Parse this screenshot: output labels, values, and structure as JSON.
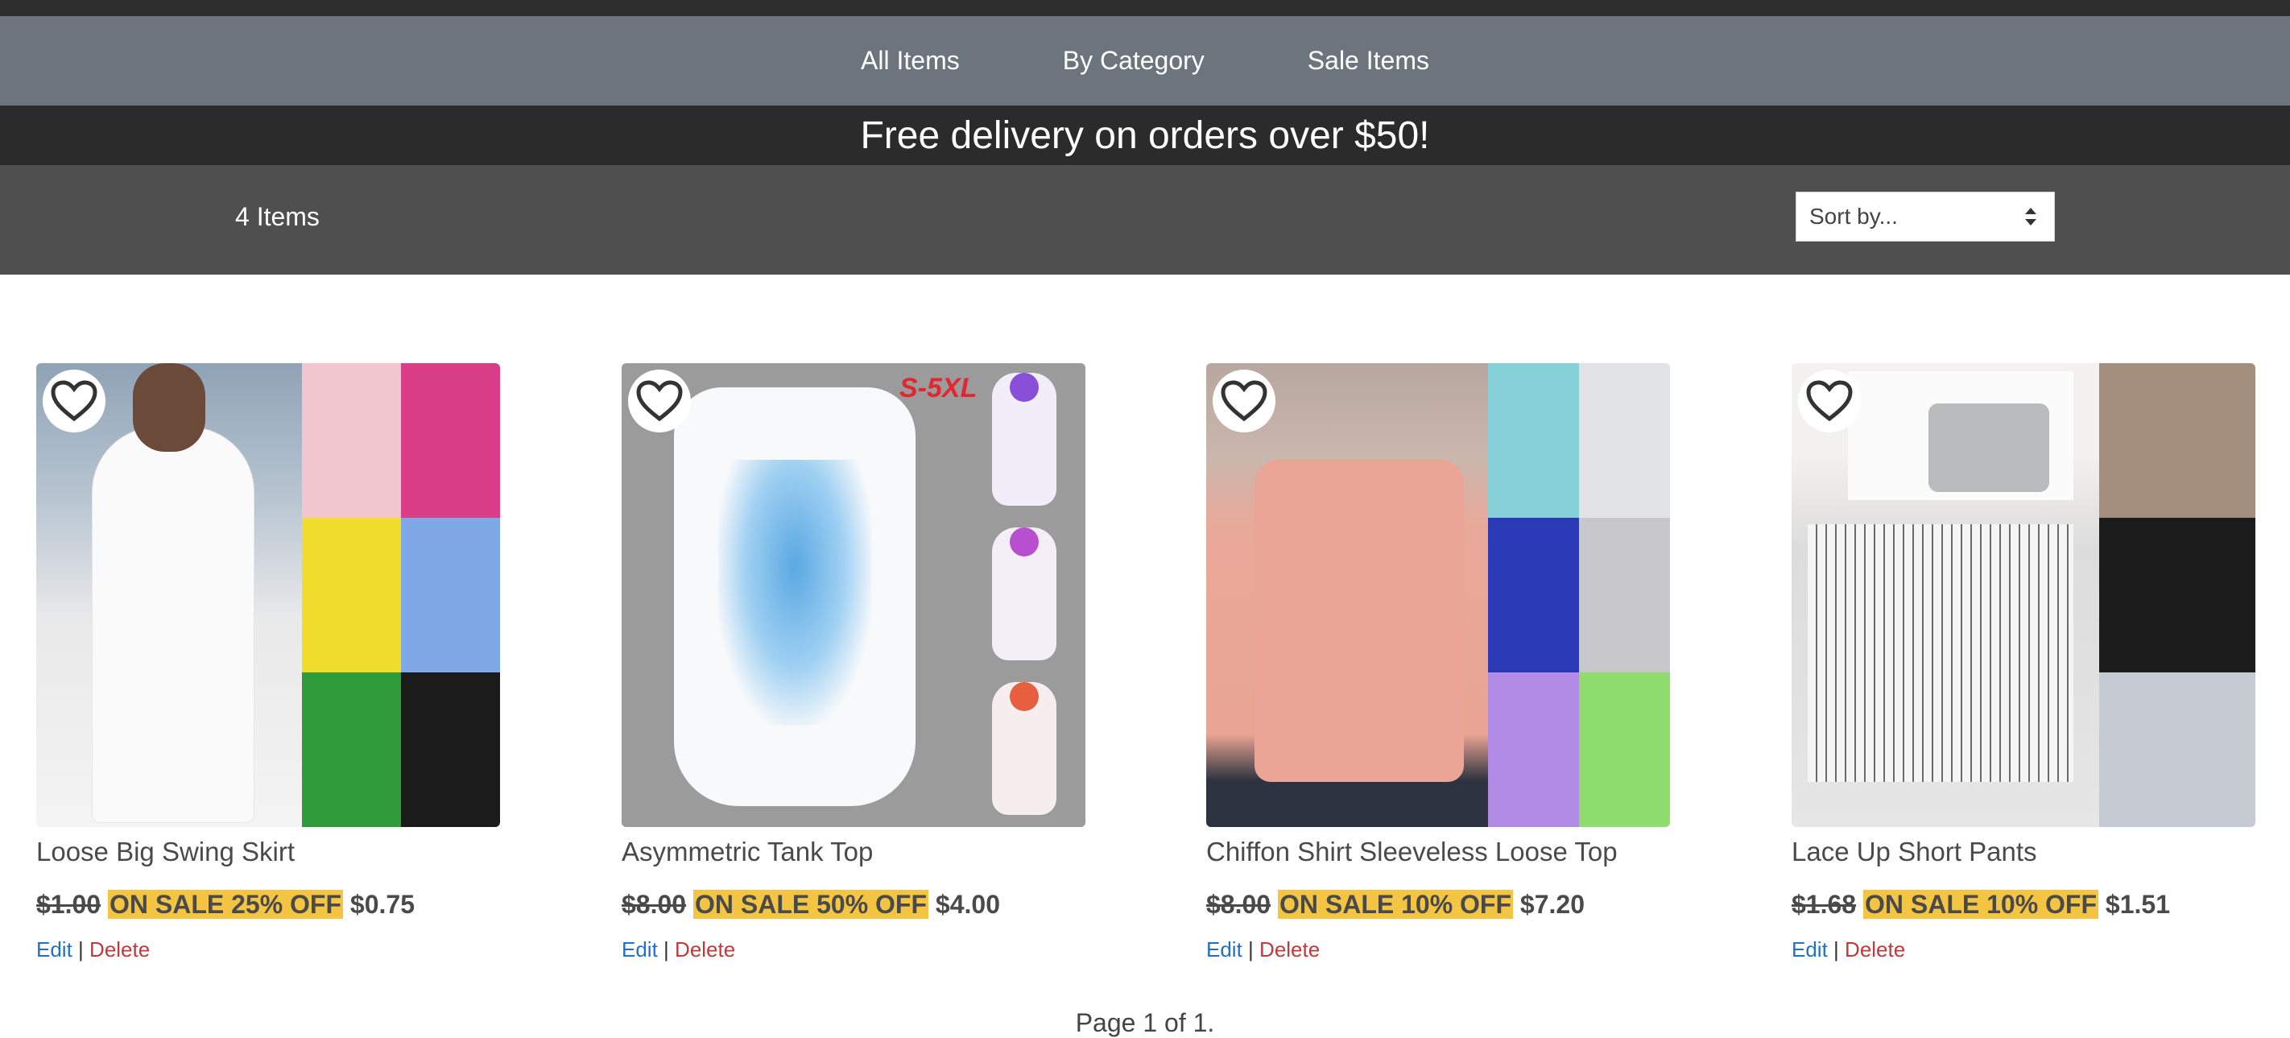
{
  "nav": {
    "items": [
      {
        "label": "All Items"
      },
      {
        "label": "By Category"
      },
      {
        "label": "Sale Items"
      }
    ]
  },
  "promo": {
    "text": "Free delivery on orders over $50!"
  },
  "toolbar": {
    "count_text": "4 Items",
    "sort_label": "Sort by..."
  },
  "products": [
    {
      "title": "Loose Big Swing Skirt",
      "old_price": "$1.00",
      "sale_badge": "ON SALE 25% OFF",
      "new_price": "$0.75",
      "edit_label": "Edit",
      "separator": "|",
      "delete_label": "Delete"
    },
    {
      "title": "Asymmetric Tank Top",
      "old_price": "$8.00",
      "sale_badge": "ON SALE 50% OFF",
      "new_price": "$4.00",
      "edit_label": "Edit",
      "separator": "|",
      "delete_label": "Delete",
      "image_text": "S-5XL"
    },
    {
      "title": "Chiffon Shirt Sleeveless Loose Top",
      "old_price": "$8.00",
      "sale_badge": "ON SALE 10% OFF",
      "new_price": "$7.20",
      "edit_label": "Edit",
      "separator": "|",
      "delete_label": "Delete"
    },
    {
      "title": "Lace Up Short Pants",
      "old_price": "$1.68",
      "sale_badge": "ON SALE 10% OFF",
      "new_price": "$1.51",
      "edit_label": "Edit",
      "separator": "|",
      "delete_label": "Delete"
    }
  ],
  "pagination": {
    "text": "Page 1 of 1."
  },
  "colors": {
    "nav_bg": "#6c757d",
    "promo_bg": "#2b2b2b",
    "toolbar_bg": "#4f4f4f",
    "sale_highlight": "#f4c542",
    "edit_link": "#1f6fcf",
    "delete_link": "#c0393b"
  },
  "icons": {
    "favorite": "heart-outline-icon",
    "sort": "sort-arrows-icon"
  }
}
